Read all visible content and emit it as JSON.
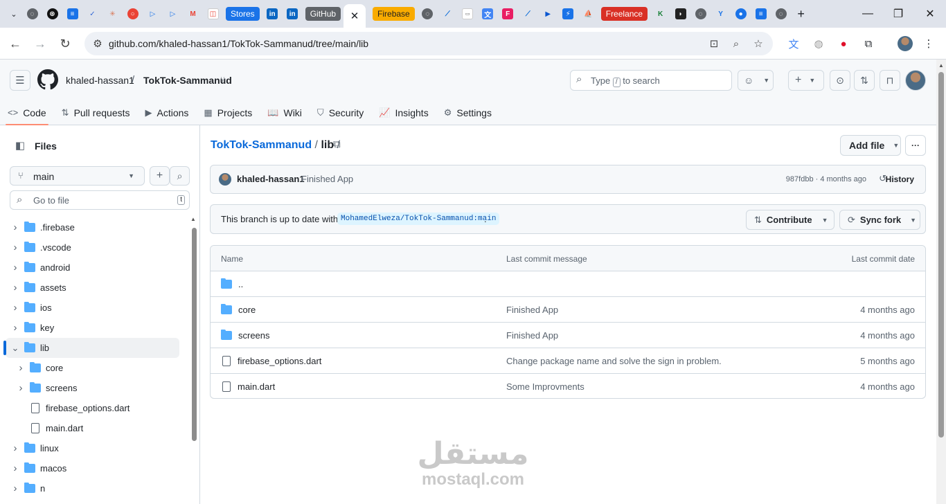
{
  "browser": {
    "tab_pills": [
      "Stores",
      "GitHub",
      "Firebase",
      "Freelance"
    ],
    "active_tab_close": "✕",
    "new_tab": "+",
    "url": "github.com/khaled-hassan1/TokTok-Sammanud/tree/main/lib"
  },
  "header": {
    "owner": "khaled-hassan1",
    "separator": "/",
    "repo": "TokTok-Sammanud",
    "search_placeholder_before": "Type",
    "search_key": "/",
    "search_placeholder_after": "to search"
  },
  "repo_nav": [
    {
      "label": "Code",
      "icon": "code-icon",
      "glyph": "<>"
    },
    {
      "label": "Pull requests",
      "icon": "pull-request-icon",
      "glyph": "⇅"
    },
    {
      "label": "Actions",
      "icon": "play-icon",
      "glyph": "▶"
    },
    {
      "label": "Projects",
      "icon": "table-icon",
      "glyph": "▦"
    },
    {
      "label": "Wiki",
      "icon": "book-icon",
      "glyph": "📖"
    },
    {
      "label": "Security",
      "icon": "shield-icon",
      "glyph": "⛉"
    },
    {
      "label": "Insights",
      "icon": "graph-icon",
      "glyph": "📈"
    },
    {
      "label": "Settings",
      "icon": "gear-icon",
      "glyph": "⚙"
    }
  ],
  "sidebar": {
    "title": "Files",
    "branch": "main",
    "go_to_file_placeholder": "Go to file",
    "go_to_file_key": "t",
    "tree": [
      {
        "name": ".firebase",
        "type": "dir",
        "depth": 0,
        "expanded": false
      },
      {
        "name": ".vscode",
        "type": "dir",
        "depth": 0,
        "expanded": false
      },
      {
        "name": "android",
        "type": "dir",
        "depth": 0,
        "expanded": false
      },
      {
        "name": "assets",
        "type": "dir",
        "depth": 0,
        "expanded": false
      },
      {
        "name": "ios",
        "type": "dir",
        "depth": 0,
        "expanded": false
      },
      {
        "name": "key",
        "type": "dir",
        "depth": 0,
        "expanded": false
      },
      {
        "name": "lib",
        "type": "dir",
        "depth": 0,
        "expanded": true,
        "selected": true
      },
      {
        "name": "core",
        "type": "dir",
        "depth": 1,
        "expanded": false
      },
      {
        "name": "screens",
        "type": "dir",
        "depth": 1,
        "expanded": false
      },
      {
        "name": "firebase_options.dart",
        "type": "file",
        "depth": 1
      },
      {
        "name": "main.dart",
        "type": "file",
        "depth": 1
      },
      {
        "name": "linux",
        "type": "dir",
        "depth": 0,
        "expanded": false
      },
      {
        "name": "macos",
        "type": "dir",
        "depth": 0,
        "expanded": false
      },
      {
        "name": "n",
        "type": "dir",
        "depth": 0,
        "expanded": false
      }
    ]
  },
  "main": {
    "breadcrumb_repo": "TokTok-Sammanud",
    "breadcrumb_sep": "/",
    "breadcrumb_dir": "lib",
    "breadcrumb_trail": "/",
    "add_file": "Add file",
    "more": "···",
    "commit": {
      "author": "khaled-hassan1",
      "message": "Finished App",
      "sha_age": "987fdbb · 4 months ago",
      "history": "History"
    },
    "branch_status": {
      "text": "This branch is up to date with",
      "ref": "MohamedElweza/TokTok-Sammanud:main",
      "trail": ".",
      "contribute": "Contribute",
      "sync_fork": "Sync fork"
    },
    "table": {
      "headers": [
        "Name",
        "Last commit message",
        "Last commit date"
      ],
      "parent": "..",
      "rows": [
        {
          "name": "core",
          "type": "dir",
          "message": "Finished App",
          "date": "4 months ago"
        },
        {
          "name": "screens",
          "type": "dir",
          "message": "Finished App",
          "date": "4 months ago"
        },
        {
          "name": "firebase_options.dart",
          "type": "file",
          "message": "Change package name and solve the sign in problem.",
          "date": "5 months ago"
        },
        {
          "name": "main.dart",
          "type": "file",
          "message": "Some Improvments",
          "date": "4 months ago"
        }
      ]
    }
  },
  "watermark": {
    "arabic": "مستقل",
    "latin": "mostaql.com"
  }
}
